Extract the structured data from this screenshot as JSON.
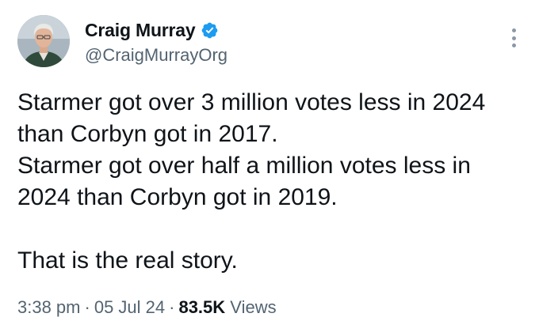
{
  "author": {
    "display_name": "Craig Murray",
    "handle": "@CraigMurrayOrg",
    "verified": true,
    "verified_color": "#1d9bf0",
    "avatar_icon": "profile-photo"
  },
  "tweet": {
    "lines": [
      "Starmer got over 3 million votes less in 2024",
      "than Corbyn got in 2017.",
      "Starmer got over half a million votes less in",
      "2024 than Corbyn got in 2019.",
      "",
      "That is the real story."
    ]
  },
  "meta": {
    "time": "3:38 pm",
    "separator": "·",
    "date": "05 Jul 24",
    "views_count": "83.5K",
    "views_label": "Views"
  },
  "colors": {
    "text_primary": "#0f1419",
    "text_secondary": "#536471"
  },
  "more_icon": "more-vertical-icon"
}
